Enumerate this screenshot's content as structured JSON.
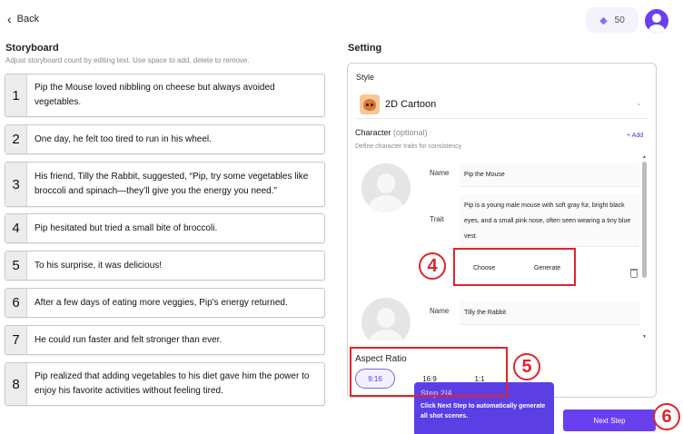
{
  "header": {
    "back_label": "Back",
    "credits": "50"
  },
  "storyboard": {
    "title": "Storyboard",
    "subtitle": "Adjust storyboard count by editing text. Use space to add, delete to remove.",
    "scenes": [
      {
        "num": "1",
        "text": "Pip the Mouse loved nibbling on cheese but always avoided vegetables."
      },
      {
        "num": "2",
        "text": "One day, he felt too tired to run in his wheel."
      },
      {
        "num": "3",
        "text": "His friend, Tilly the Rabbit, suggested, “Pip, try some vegetables like broccoli and spinach—they’ll give you the energy you need.”"
      },
      {
        "num": "4",
        "text": "Pip hesitated but tried a small bite of broccoli."
      },
      {
        "num": "5",
        "text": "To his surprise, it was delicious!"
      },
      {
        "num": "6",
        "text": "After a few days of eating more veggies, Pip's energy returned."
      },
      {
        "num": "7",
        "text": "He could run faster and felt stronger than ever."
      },
      {
        "num": "8",
        "text": "Pip realized that adding vegetables to his diet gave him the power to enjoy his favorite activities without feeling tired."
      }
    ]
  },
  "setting": {
    "title": "Setting",
    "style_label": "Style",
    "style_value": "2D Cartoon",
    "character_label": "Character",
    "character_optional": "(optional)",
    "character_sub": "Define character traits for consistency",
    "add_label": "+ Add",
    "name_label": "Name",
    "trait_label": "Trait",
    "characters": [
      {
        "name": "Pip the Mouse",
        "trait": "Pip is a young male mouse with soft gray fur, bright black eyes, and a small pink nose, often seen wearing a tiny blue vest."
      },
      {
        "name": "Tilly the Rabbit"
      }
    ],
    "choose_label": "Choose",
    "generate_label": "Generate",
    "aspect_ratio_label": "Aspect Ratio",
    "aspect_options": [
      "9:16",
      "16:9",
      "1:1"
    ],
    "aspect_selected": "9:16"
  },
  "tour": {
    "step_title": "Step 2/4",
    "text": "Click Next Step to automatically generate all shot scenes."
  },
  "next_step_label": "Next Step",
  "annotations": [
    "4",
    "5",
    "6"
  ],
  "colors": {
    "accent": "#6a3ff0",
    "annotation_red": "#e0242c"
  }
}
